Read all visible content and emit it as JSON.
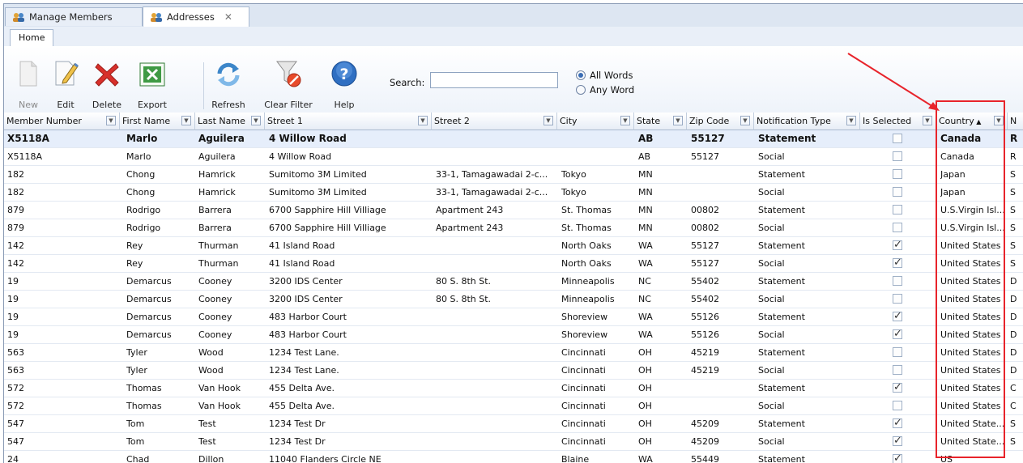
{
  "window_tabs": [
    {
      "label": "Manage Members",
      "active": false
    },
    {
      "label": "Addresses",
      "active": true,
      "closable": true
    }
  ],
  "ribbon": {
    "tab": "Home",
    "buttons": {
      "new": "New",
      "edit": "Edit",
      "delete": "Delete",
      "export": "Export",
      "refresh": "Refresh",
      "clear_filter": "Clear Filter",
      "help": "Help"
    },
    "search_label": "Search:",
    "search_value": "",
    "options": [
      "All Words",
      "Any Word"
    ],
    "selected_option": "All Words"
  },
  "columns": [
    "Member Number",
    "First Name",
    "Last Name",
    "Street 1",
    "Street 2",
    "City",
    "State",
    "Zip Code",
    "Notification Type",
    "Is Selected",
    "Country",
    "N"
  ],
  "sort": {
    "column": "Country",
    "direction": "asc"
  },
  "rows": [
    {
      "member": "X5118A",
      "first": "Marlo",
      "last": "Aguilera",
      "street1": "4 Willow Road",
      "street2": "",
      "city": "",
      "state": "AB",
      "zip": "55127",
      "type": "Statement",
      "selected": false,
      "country": "Canada",
      "extra": "R"
    },
    {
      "member": "X5118A",
      "first": "Marlo",
      "last": "Aguilera",
      "street1": "4 Willow Road",
      "street2": "",
      "city": "",
      "state": "AB",
      "zip": "55127",
      "type": "Social",
      "selected": false,
      "country": "Canada",
      "extra": "R"
    },
    {
      "member": "182",
      "first": "Chong",
      "last": "Hamrick",
      "street1": "Sumitomo 3M Limited",
      "street2": "33-1, Tamagawadai 2-c...",
      "city": "Tokyo",
      "state": "MN",
      "zip": "",
      "type": "Statement",
      "selected": false,
      "country": "Japan",
      "extra": "S"
    },
    {
      "member": "182",
      "first": "Chong",
      "last": "Hamrick",
      "street1": "Sumitomo 3M Limited",
      "street2": "33-1, Tamagawadai 2-c...",
      "city": "Tokyo",
      "state": "MN",
      "zip": "",
      "type": "Social",
      "selected": false,
      "country": "Japan",
      "extra": "S"
    },
    {
      "member": "879",
      "first": "Rodrigo",
      "last": "Barrera",
      "street1": "6700 Sapphire Hill Villiage",
      "street2": "Apartment 243",
      "city": "St. Thomas",
      "state": "MN",
      "zip": "00802",
      "type": "Statement",
      "selected": false,
      "country": "U.S.Virgin Isl...",
      "extra": "S"
    },
    {
      "member": "879",
      "first": "Rodrigo",
      "last": "Barrera",
      "street1": "6700 Sapphire Hill Villiage",
      "street2": "Apartment 243",
      "city": "St. Thomas",
      "state": "MN",
      "zip": "00802",
      "type": "Social",
      "selected": false,
      "country": "U.S.Virgin Isl...",
      "extra": "S"
    },
    {
      "member": "142",
      "first": "Rey",
      "last": "Thurman",
      "street1": "41 Island Road",
      "street2": "",
      "city": "North Oaks",
      "state": "WA",
      "zip": "55127",
      "type": "Statement",
      "selected": true,
      "country": "United States",
      "extra": "S"
    },
    {
      "member": "142",
      "first": "Rey",
      "last": "Thurman",
      "street1": "41 Island Road",
      "street2": "",
      "city": "North Oaks",
      "state": "WA",
      "zip": "55127",
      "type": "Social",
      "selected": true,
      "country": "United States",
      "extra": "S"
    },
    {
      "member": "19",
      "first": "Demarcus",
      "last": "Cooney",
      "street1": "3200 IDS Center",
      "street2": "80 S. 8th St.",
      "city": "Minneapolis",
      "state": "NC",
      "zip": "55402",
      "type": "Statement",
      "selected": false,
      "country": "United States",
      "extra": "D"
    },
    {
      "member": "19",
      "first": "Demarcus",
      "last": "Cooney",
      "street1": "3200 IDS Center",
      "street2": "80 S. 8th St.",
      "city": "Minneapolis",
      "state": "NC",
      "zip": "55402",
      "type": "Social",
      "selected": false,
      "country": "United States",
      "extra": "D"
    },
    {
      "member": "19",
      "first": "Demarcus",
      "last": "Cooney",
      "street1": "483 Harbor Court",
      "street2": "",
      "city": "Shoreview",
      "state": "WA",
      "zip": "55126",
      "type": "Statement",
      "selected": true,
      "country": "United States",
      "extra": "D"
    },
    {
      "member": "19",
      "first": "Demarcus",
      "last": "Cooney",
      "street1": "483 Harbor Court",
      "street2": "",
      "city": "Shoreview",
      "state": "WA",
      "zip": "55126",
      "type": "Social",
      "selected": true,
      "country": "United States",
      "extra": "D"
    },
    {
      "member": "563",
      "first": "Tyler",
      "last": "Wood",
      "street1": "1234 Test Lane.",
      "street2": "",
      "city": "Cincinnati",
      "state": "OH",
      "zip": "45219",
      "type": "Statement",
      "selected": false,
      "country": "United States",
      "extra": "D"
    },
    {
      "member": "563",
      "first": "Tyler",
      "last": "Wood",
      "street1": "1234 Test Lane.",
      "street2": "",
      "city": "Cincinnati",
      "state": "OH",
      "zip": "45219",
      "type": "Social",
      "selected": false,
      "country": "United States",
      "extra": "D"
    },
    {
      "member": "572",
      "first": "Thomas",
      "last": "Van Hook",
      "street1": "455 Delta Ave.",
      "street2": "",
      "city": "Cincinnati",
      "state": "OH",
      "zip": "",
      "type": "Statement",
      "selected": true,
      "country": "United States",
      "extra": "C"
    },
    {
      "member": "572",
      "first": "Thomas",
      "last": "Van Hook",
      "street1": "455 Delta Ave.",
      "street2": "",
      "city": "Cincinnati",
      "state": "OH",
      "zip": "",
      "type": "Social",
      "selected": false,
      "country": "United States",
      "extra": "C"
    },
    {
      "member": "547",
      "first": "Tom",
      "last": "Test",
      "street1": "1234 Test Dr",
      "street2": "",
      "city": "Cincinnati",
      "state": "OH",
      "zip": "45209",
      "type": "Statement",
      "selected": true,
      "country": "United State...",
      "extra": "S"
    },
    {
      "member": "547",
      "first": "Tom",
      "last": "Test",
      "street1": "1234 Test Dr",
      "street2": "",
      "city": "Cincinnati",
      "state": "OH",
      "zip": "45209",
      "type": "Social",
      "selected": true,
      "country": "United State...",
      "extra": "S"
    },
    {
      "member": "24",
      "first": "Chad",
      "last": "Dillon",
      "street1": "11040 Flanders Circle NE",
      "street2": "",
      "city": "Blaine",
      "state": "WA",
      "zip": "55449",
      "type": "Statement",
      "selected": true,
      "country": "US",
      "extra": ""
    }
  ],
  "colors": {
    "annotation": "#e8242b",
    "accent": "#3a6db5",
    "header_bg": "#dde6f2"
  },
  "icons": {
    "new": "document-icon",
    "edit": "edit-icon",
    "delete": "delete-x-icon",
    "export": "excel-icon",
    "refresh": "refresh-icon",
    "clear_filter": "clear-filter-icon",
    "help": "help-icon",
    "tab": "people-icon"
  }
}
